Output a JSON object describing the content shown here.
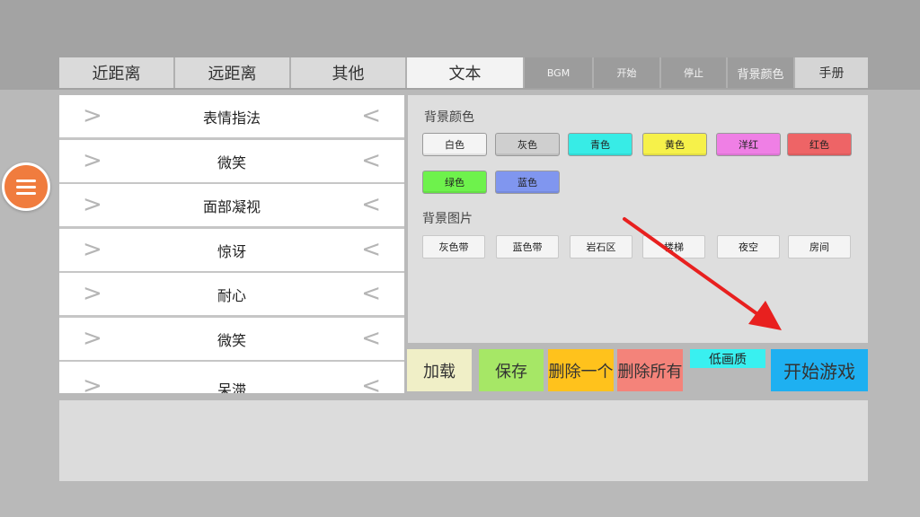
{
  "tabs": [
    {
      "label": "近距离",
      "style": "light"
    },
    {
      "label": "远距离",
      "style": "light"
    },
    {
      "label": "其他",
      "style": "light"
    },
    {
      "label": "文本",
      "style": "active"
    },
    {
      "label": "BGM",
      "style": "dark"
    },
    {
      "label": "开始",
      "style": "dark"
    },
    {
      "label": "停止",
      "style": "dark"
    },
    {
      "label": "背景颜色",
      "style": "dark wide"
    },
    {
      "label": "手册",
      "style": "manual"
    }
  ],
  "expression_list": {
    "prev_symbol": ">",
    "next_symbol": "<",
    "items": [
      "表情指法",
      "微笑",
      "面部凝视",
      "惊讶",
      "耐心",
      "微笑",
      "呆滞"
    ]
  },
  "background_panel": {
    "color_label": "背景颜色",
    "colors": [
      {
        "label": "白色",
        "color": "#f4f4f4"
      },
      {
        "label": "灰色",
        "color": "#cfcfcf"
      },
      {
        "label": "青色",
        "color": "#37ece6"
      },
      {
        "label": "黄色",
        "color": "#f6f14a"
      },
      {
        "label": "洋红",
        "color": "#ef7fe5"
      },
      {
        "label": "红色",
        "color": "#ee6466"
      },
      {
        "label": "绿色",
        "color": "#6ef24c"
      },
      {
        "label": "蓝色",
        "color": "#8096ef"
      }
    ],
    "image_label": "背景图片",
    "images": [
      "灰色带",
      "蓝色带",
      "岩石区",
      "楼梯",
      "夜空",
      "房间"
    ]
  },
  "actions": {
    "load": {
      "label": "加载",
      "color": "#f0efc7"
    },
    "save": {
      "label": "保存",
      "color": "#a6e766"
    },
    "delete_one": {
      "label": "删除一个",
      "color": "#ffc21c"
    },
    "delete_all": {
      "label": "删除所有",
      "color": "#f4837a"
    },
    "low_quality": {
      "label": "低画质",
      "color": "#39f0f0"
    },
    "start_game": {
      "label": "开始游戏",
      "color": "#1eb0f1"
    }
  },
  "menu_button": {
    "icon": "hamburger-menu-icon",
    "color": "#f07c3e"
  },
  "annotation": {
    "icon": "red-arrow-icon",
    "color": "#e8201f"
  }
}
